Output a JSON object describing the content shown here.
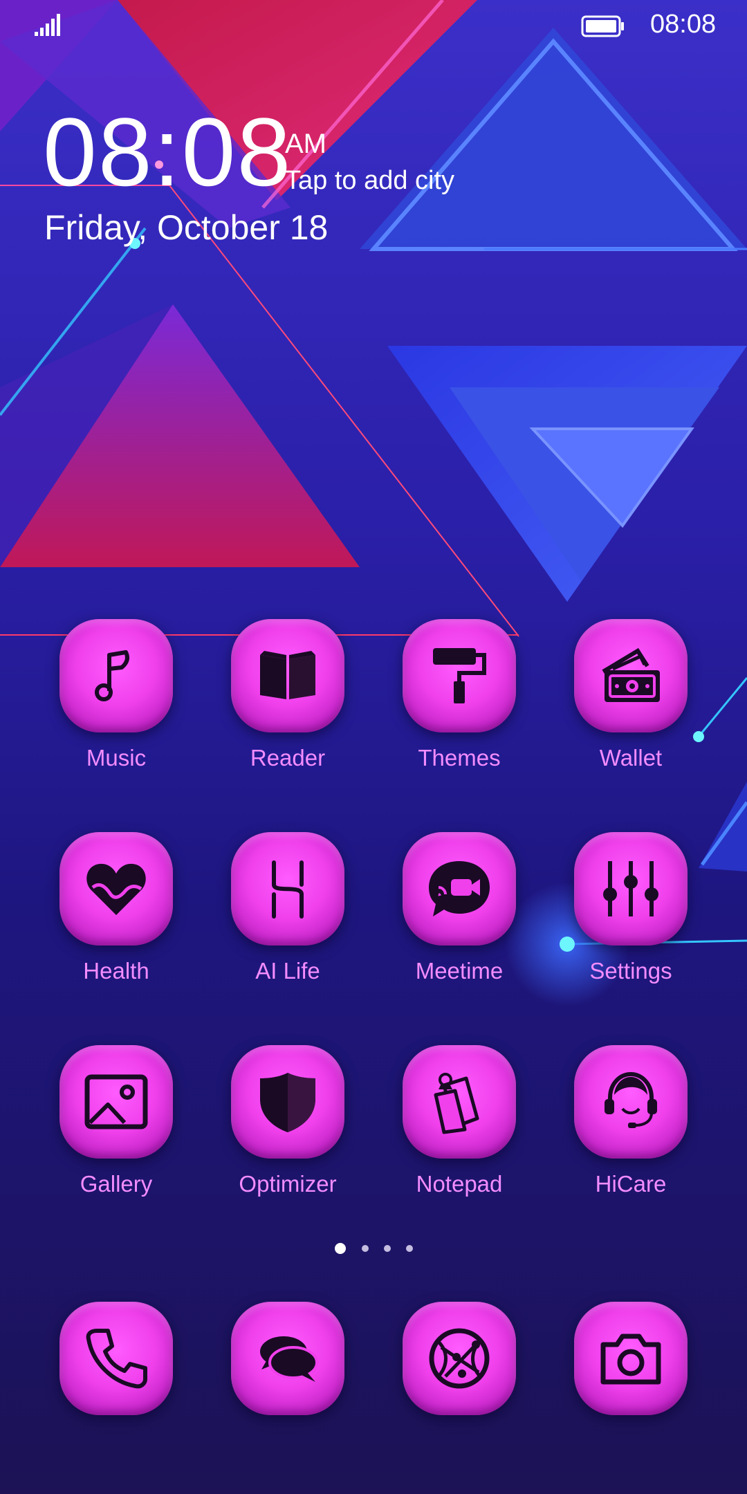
{
  "status_bar": {
    "time": "08:08",
    "signal_icon": "signal-bars-icon",
    "battery_icon": "battery-full-icon"
  },
  "clock_widget": {
    "time": "08:08",
    "ampm": "AM",
    "city": "Tap to add city",
    "date": "Friday, October 18"
  },
  "apps": [
    {
      "label": "Music",
      "icon": "music-note-icon"
    },
    {
      "label": "Reader",
      "icon": "open-book-icon"
    },
    {
      "label": "Themes",
      "icon": "paint-roller-icon"
    },
    {
      "label": "Wallet",
      "icon": "wallet-cash-icon"
    },
    {
      "label": "Health",
      "icon": "heart-icon"
    },
    {
      "label": "AI Life",
      "icon": "ai-life-icon"
    },
    {
      "label": "Meetime",
      "icon": "video-chat-icon"
    },
    {
      "label": "Settings",
      "icon": "sliders-icon"
    },
    {
      "label": "Gallery",
      "icon": "image-icon"
    },
    {
      "label": "Optimizer",
      "icon": "shield-icon"
    },
    {
      "label": "Notepad",
      "icon": "notepad-icon"
    },
    {
      "label": "HiCare",
      "icon": "headset-icon"
    }
  ],
  "page_indicator": {
    "pages": 4,
    "current": 1
  },
  "dock": [
    {
      "icon": "phone-icon"
    },
    {
      "icon": "messages-icon"
    },
    {
      "icon": "browser-globe-icon"
    },
    {
      "icon": "camera-icon"
    }
  ],
  "colors": {
    "icon_tile": "#f040ec",
    "label": "#f38cff",
    "glyph": "#1a0a24"
  }
}
